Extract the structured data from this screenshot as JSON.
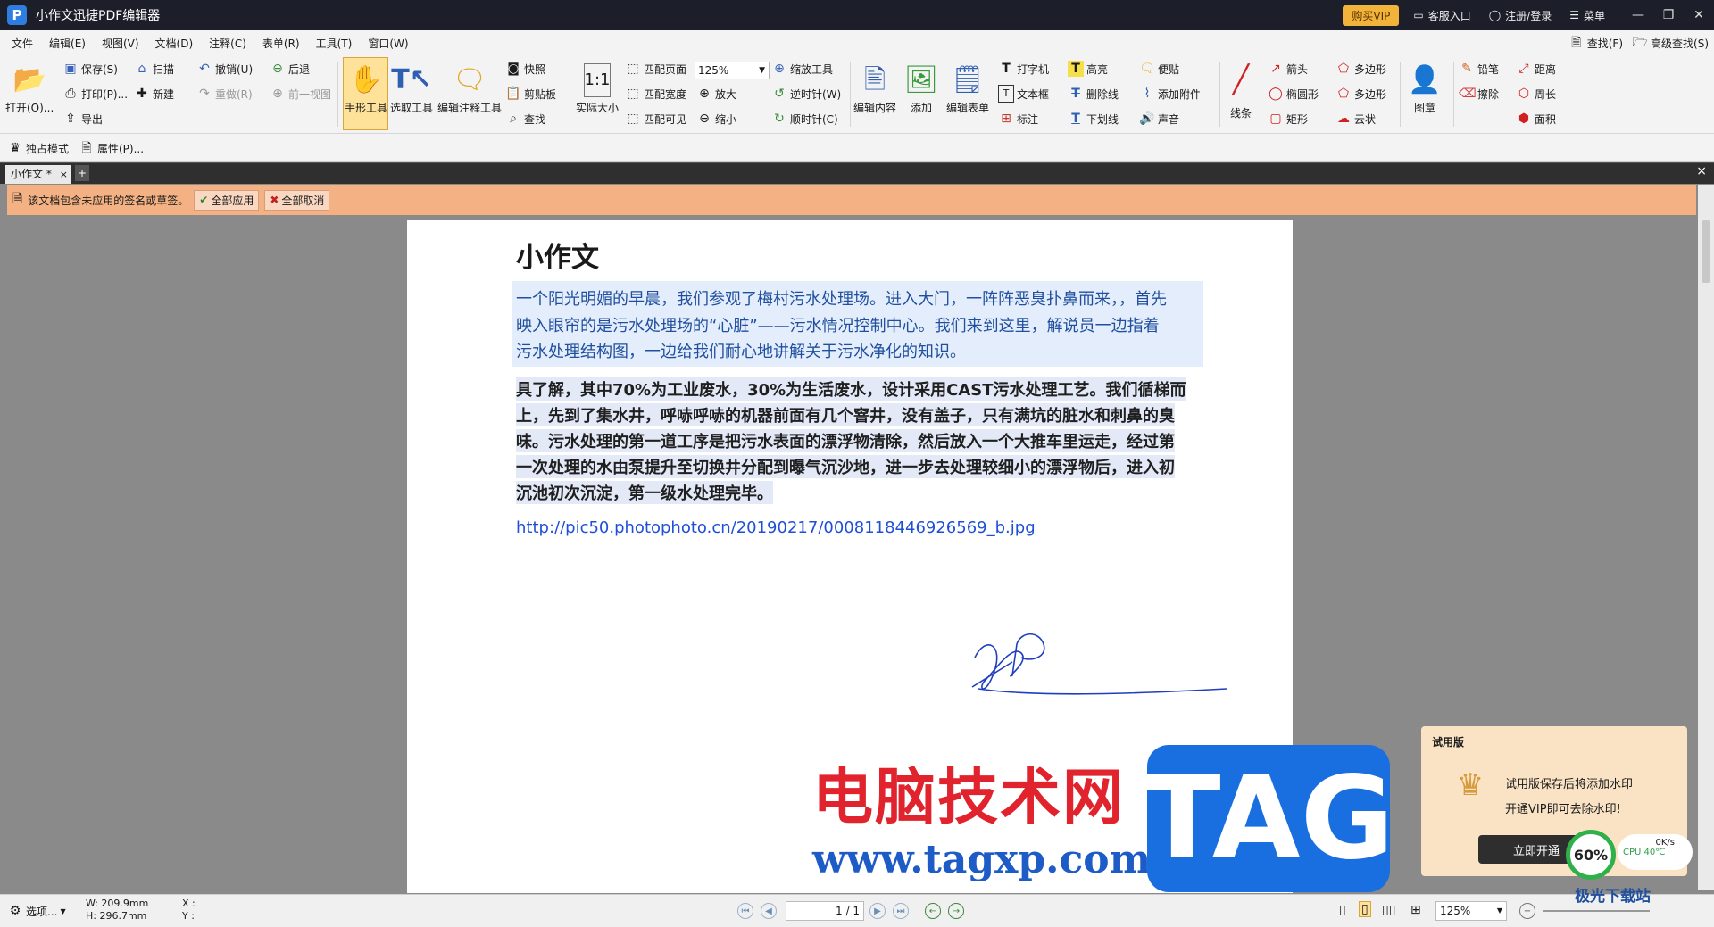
{
  "app": {
    "title": "小作文迅捷PDF编辑器",
    "buy_vip": "购买VIP",
    "support": "客服入口",
    "login": "注册/登录",
    "menu": "菜单"
  },
  "menubar": {
    "items": [
      "文件",
      "编辑(E)",
      "视图(V)",
      "文档(D)",
      "注释(C)",
      "表单(R)",
      "工具(T)",
      "窗口(W)"
    ],
    "find": "查找(F)",
    "advanced_find": "高级查找(S)"
  },
  "ribbon": {
    "open": "打开(O)...",
    "save": "保存(S)",
    "print": "打印(P)...",
    "export": "导出",
    "scan": "扫描",
    "new": "新建",
    "undo": "撤销(U)",
    "redo": "重做(R)",
    "back": "后退",
    "prev_view": "前一视图",
    "hand_tool": "手形工具",
    "select_tool": "选取工具",
    "edit_annot_tool": "编辑注释工具",
    "snapshot": "快照",
    "clipboard": "剪贴板",
    "find": "查找",
    "actual_size": "实际大小",
    "fit_page": "匹配页面",
    "fit_width": "匹配宽度",
    "fit_visible": "匹配可见",
    "zoom_value": "125%",
    "zoom_tool": "缩放工具",
    "zoom_in": "放大",
    "zoom_out": "缩小",
    "rotate_ccw": "逆时针(W)",
    "rotate_cw": "顺时针(C)",
    "edit_content": "编辑内容",
    "add": "添加",
    "edit_form": "编辑表单",
    "typewriter": "打字机",
    "textbox": "文本框",
    "callout": "标注",
    "highlight": "高亮",
    "strikeout": "删除线",
    "underline": "下划线",
    "note": "便贴",
    "attach": "添加附件",
    "sound": "声音",
    "line": "线条",
    "arrow": "箭头",
    "ellipse": "椭圆形",
    "rect": "矩形",
    "polygon": "多边形",
    "polyline": "多边形",
    "cloud": "云状",
    "stamp": "图章",
    "pencil": "铅笔",
    "eraser": "擦除",
    "distance": "距离",
    "perimeter": "周长",
    "area": "面积"
  },
  "toolbar2": {
    "exclusive": "独占模式",
    "properties": "属性(P)..."
  },
  "tabs": {
    "doc_tab": "小作文 *",
    "close": "×",
    "add": "+"
  },
  "sigbar": {
    "message": "该文档包含未应用的签名或草签。",
    "apply_all": "全部应用",
    "cancel_all": "全部取消"
  },
  "document": {
    "title": "小作文",
    "para1": [
      "一个阳光明媚的早晨，我们参观了梅村污水处理场。进入大门，一阵阵恶臭扑鼻而来，，首先",
      "映入眼帘的是污水处理场的“心脏”——污水情况控制中心。我们来到这里，解说员一边指着",
      "污水处理结构图，一边给我们耐心地讲解关于污水净化的知识。"
    ],
    "para2": [
      "具了解，其中70%为工业废水，30%为生活废水，设计采用CAST污水处理工艺。我们循梯而",
      "上，先到了集水井，呼哧呼哧的机器前面有几个窨井，没有盖子，只有满坑的脏水和刺鼻的臭",
      "味。污水处理的第一道工序是把污水表面的漂浮物清除，然后放入一个大推车里运走，经过第",
      "一次处理的水由泵提升至切换井分配到曝气沉沙地，进一步去处理较细小的漂浮物后，进入初",
      "沉池初次沉淀，第一级水处理完毕。"
    ],
    "link": "http://pic50.photophoto.cn/20190217/0008118446926569_b.jpg"
  },
  "watermark": {
    "site_name": "电脑技术网",
    "site_url": "www.tagxp.com",
    "tag": "TAG",
    "corner_site": "极光下载站"
  },
  "trial": {
    "title": "试用版",
    "line1": "试用版保存后将添加水印",
    "line2": "开通VIP即可去除水印!",
    "button": "立即开通",
    "cpu_percent": "60%",
    "net": "0K/s",
    "cpu_temp": "CPU 40℃"
  },
  "status": {
    "select": "选项...",
    "width": "W: 209.9mm",
    "height": "H: 296.7mm",
    "x": "X :",
    "y": "Y :",
    "page": "1 / 1",
    "zoom": "125%"
  },
  "colors": {
    "accent": "#2f7de1",
    "vip": "#f2b33a",
    "sigbar": "#f3b184",
    "link": "#1f4fd6"
  }
}
